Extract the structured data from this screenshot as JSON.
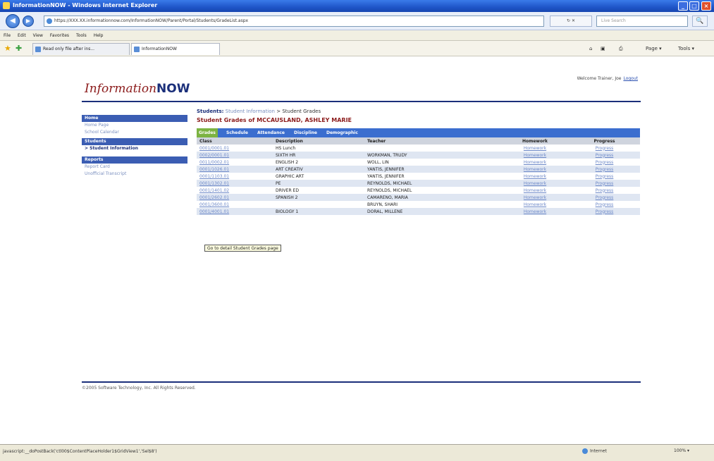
{
  "window": {
    "title": "InformationNOW - Windows Internet Explorer",
    "minimize": "_",
    "maximize": "□",
    "close": "×"
  },
  "address": {
    "back": "◀",
    "forward": "▶",
    "url": "https://XXX.XX.informationnow.com/InformationNOW/Parent/Portal/Students/GradeList.aspx",
    "refresh_stop": "↻ ✕",
    "search_placeholder": "Live Search",
    "search_button": "🔍"
  },
  "menu": [
    "File",
    "Edit",
    "View",
    "Favorites",
    "Tools",
    "Help"
  ],
  "tabs_bar": {
    "tab1": "Read only file after ins...",
    "tab2": "InformationNOW",
    "home": "⌂",
    "feeds": "▣",
    "print": "⎙",
    "page": "Page ▾",
    "tools": "Tools ▾"
  },
  "page": {
    "welcome": "Welcome Trainer, Joe",
    "logout": "Logout",
    "logo_main": "Information",
    "logo_now": "NOW",
    "nav": {
      "home_header": "Home",
      "home_links": [
        "Home Page",
        "School Calendar"
      ],
      "students_header": "Students",
      "students_links": [
        "> Student Information"
      ],
      "reports_header": "Reports",
      "reports_links": [
        "Report Card",
        "Unofficial Transcript"
      ]
    },
    "breadcrumb": {
      "label": "Students:",
      "link": "Student Information",
      "sep": ">",
      "current": "Student Grades"
    },
    "title": "Student Grades of MCCAUSLAND, ASHLEY MARIE",
    "tabs": [
      "Grades",
      "Schedule",
      "Attendance",
      "Discipline",
      "Demographic"
    ],
    "table": {
      "headers": [
        "Class",
        "Description",
        "Teacher",
        "Homework",
        "Progress"
      ],
      "rows": [
        [
          "0001/0001.01",
          "HS Lunch",
          "",
          "Homework",
          "Progress"
        ],
        [
          "0002/0001.01",
          "SIXTH HR",
          "WORKMAN, TRUDY",
          "Homework",
          "Progress"
        ],
        [
          "0011/0002.01",
          "ENGLISH 2",
          "WOLL, LIN",
          "Homework",
          "Progress"
        ],
        [
          "0001/1026.01",
          "ART CREATIV",
          "YANTIS, JENNIFER",
          "Homework",
          "Progress"
        ],
        [
          "0001/1103.01",
          "GRAPHIC ART",
          "YANTIS, JENNIFER",
          "Homework",
          "Progress"
        ],
        [
          "0001/1302.01",
          "PE",
          "REYNOLDS, MICHAEL",
          "Homework",
          "Progress"
        ],
        [
          "0001/1401.02",
          "DRIVER ED",
          "REYNOLDS, MICHAEL",
          "Homework",
          "Progress"
        ],
        [
          "0001/2602.01",
          "SPANISH 2",
          "CAMARENO, MARIA",
          "Homework",
          "Progress"
        ],
        [
          "0001/3600.01",
          "",
          "BRUYN, SHARI",
          "Homework",
          "Progress"
        ],
        [
          "0001/4001.01",
          "BIOLOGY 1",
          "DORAL, MILLENE",
          "Homework",
          "Progress"
        ]
      ]
    },
    "tooltip": "Go to detail Student Grades page",
    "copyright": "©2005 Software Technology, Inc. All Rights Reserved."
  },
  "status": {
    "text": "javascript:__doPostBack('ctl00$ContentPlaceHolder1$GridView1','Sel$8')",
    "zone": "Internet",
    "zoom": "100% ▾"
  }
}
